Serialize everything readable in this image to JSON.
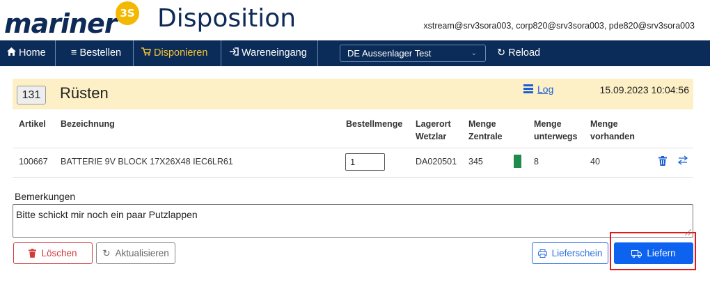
{
  "header": {
    "logo_text": "mariner",
    "logo_badge": "3S",
    "app_title": "Disposition",
    "user_info": "xstream@srv3sora003, corp820@srv3sora003, pde820@srv3sora003"
  },
  "nav": {
    "items": [
      {
        "label": "Home",
        "icon": "home-icon"
      },
      {
        "label": "Bestellen",
        "icon": "menu-icon"
      },
      {
        "label": "Disponieren",
        "icon": "cart-icon",
        "active": true
      },
      {
        "label": "Wareneingang",
        "icon": "login-icon"
      }
    ],
    "location_select": "DE Aussenlager Test",
    "reload_label": "Reload"
  },
  "order": {
    "number": "131",
    "state": "Rüsten",
    "log_label": "Log",
    "date": "15.09.2023 10:04:56"
  },
  "table": {
    "headers": {
      "artikel": "Artikel",
      "bezeichnung": "Bezeichnung",
      "bestellmenge": "Bestellmenge",
      "lagerort_1": "Lagerort",
      "lagerort_2": "Wetzlar",
      "zentrale_1": "Menge",
      "zentrale_2": "Zentrale",
      "unterwegs_1": "Menge",
      "unterwegs_2": "unterwegs",
      "vorhanden_1": "Menge",
      "vorhanden_2": "vorhanden"
    },
    "rows": [
      {
        "artikel": "100667",
        "bezeichnung": "BATTERIE 9V BLOCK 17X26X48 IEC6LR61",
        "bestellmenge": "1",
        "lagerort": "DA020501",
        "zentrale": "345",
        "unterwegs": "8",
        "vorhanden": "40",
        "status_color": "#1f8a4c"
      }
    ]
  },
  "remarks": {
    "label": "Bemerkungen",
    "text": "Bitte schickt mir noch ein paar Putzlappen"
  },
  "buttons": {
    "delete": "Löschen",
    "refresh": "Aktualisieren",
    "delivery_note": "Lieferschein",
    "deliver": "Liefern"
  },
  "colors": {
    "nav_bg": "#0b2c58",
    "nav_active": "#f6c233",
    "band_bg": "#fdf0c6",
    "primary": "#0d62f0",
    "danger": "#d23a3a",
    "highlight": "#e01919"
  }
}
